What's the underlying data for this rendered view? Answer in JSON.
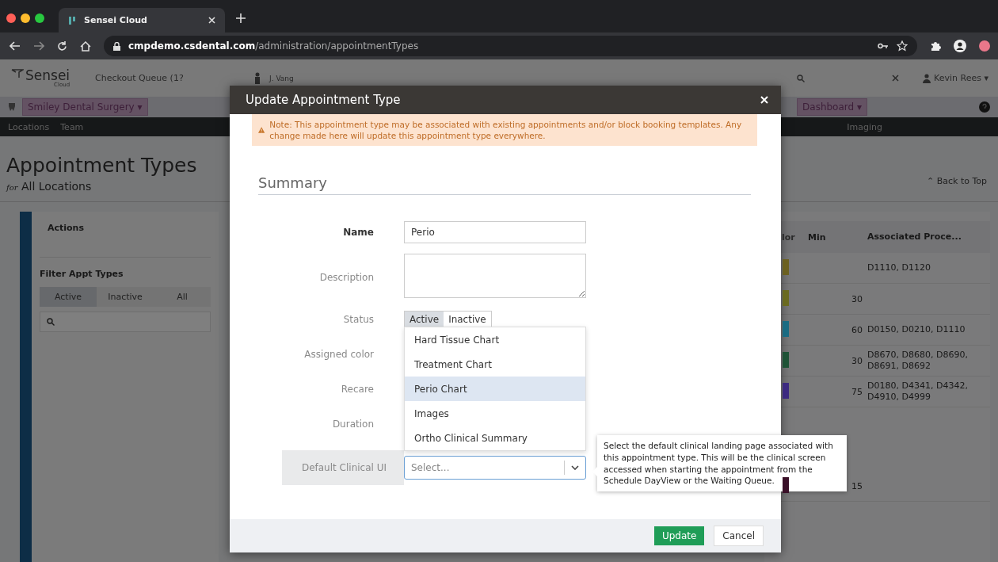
{
  "browser": {
    "tab_title": "Sensei Cloud",
    "url_host": "cmpdemo.csdental.com",
    "url_path": "/administration/appointmentTypes"
  },
  "app_header": {
    "logo": "Sensei",
    "logo_sub": "Cloud",
    "checkout_queue": "Checkout Queue (1?",
    "provider": "J. Vang",
    "user": "Kevin Rees ▾"
  },
  "location_bar": {
    "location": "Smiley Dental Surgery ▾",
    "dashboard": "Dashboard ▾"
  },
  "nav": [
    "Locations",
    "Team",
    "Imaging"
  ],
  "page": {
    "title": "Appointment Types",
    "subtitle_prefix": "for",
    "subtitle": "All Locations",
    "back_to_top": "⌃ Back to Top"
  },
  "sidebar": {
    "actions_title": "Actions",
    "filter_title": "Filter Appt Types",
    "filters": [
      {
        "label": "Active",
        "selected": true
      },
      {
        "label": "Inactive",
        "selected": false
      },
      {
        "label": "All",
        "selected": false
      }
    ]
  },
  "table": {
    "columns": [
      "lor",
      "Min",
      "Associated Proce..."
    ],
    "rows": [
      {
        "color": "#6b6020",
        "procedures": "D1110, D1120"
      },
      {
        "color": "#6a6a20",
        "min": "30"
      },
      {
        "color": "#1a6b82",
        "min": "60",
        "procedures": "D0150, D0210, D1110"
      },
      {
        "color": "#1e5236",
        "min": "30",
        "procedures": "D8670, D8680, D8690, D8691, D8692"
      },
      {
        "color": "#3c2a80",
        "min": "75",
        "procedures": "D0180, D4341, D4342, D4910, D4999"
      },
      {
        "color": "#3a1028",
        "min": "15"
      }
    ]
  },
  "modal": {
    "title": "Update Appointment Type",
    "note": "Note: This appointment type may be associated with existing appointments and/or block booking templates. Any change made here will update this appointment type everywhere.",
    "section": "Summary",
    "fields": [
      {
        "label": "Name",
        "kind": "text",
        "required": true,
        "value": "Perio"
      },
      {
        "label": "Description",
        "kind": "textarea",
        "required": false
      },
      {
        "label": "Status",
        "kind": "toggle",
        "required": false,
        "options": [
          {
            "label": "Active",
            "selected": true
          },
          {
            "label": "Inactive",
            "selected": false
          }
        ]
      },
      {
        "label": "Assigned color",
        "kind": "covered",
        "required": false
      },
      {
        "label": "Recare",
        "kind": "covered",
        "required": false
      },
      {
        "label": "Duration",
        "kind": "covered",
        "required": false
      },
      {
        "label": "Default Clinical UI",
        "kind": "select",
        "required": false,
        "highlighted": true,
        "placeholder": "Select..."
      }
    ],
    "dropdown": [
      {
        "label": "Hard Tissue Chart",
        "selected": false
      },
      {
        "label": "Treatment Chart",
        "selected": false
      },
      {
        "label": "Perio Chart",
        "selected": true
      },
      {
        "label": "Images",
        "selected": false
      },
      {
        "label": "Ortho Clinical Summary",
        "selected": false
      }
    ],
    "tooltip": "Select the default clinical landing page associated with this appointment type. This will be the clinical screen accessed when starting the appointment from the Schedule DayView or the Waiting Queue.",
    "buttons": [
      {
        "label": "Update",
        "kind": "primary"
      },
      {
        "label": "Cancel",
        "kind": "secondary"
      }
    ]
  }
}
